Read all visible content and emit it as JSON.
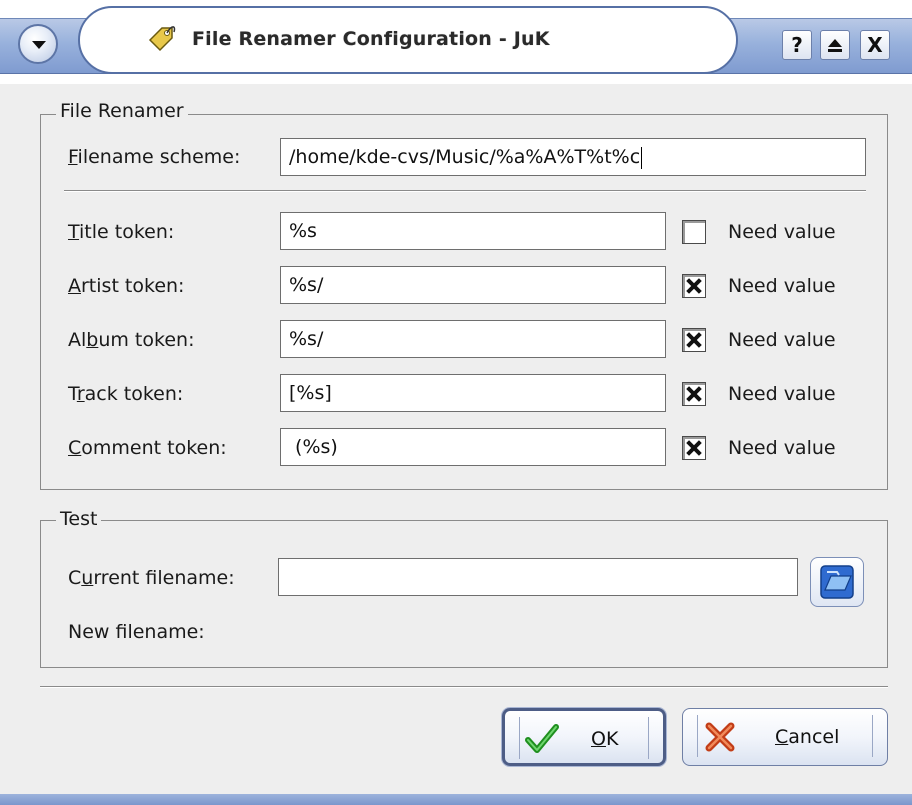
{
  "window": {
    "title": "File Renamer Configuration - JuK",
    "buttons": {
      "help": "?",
      "maximize": "▲",
      "close": "X"
    }
  },
  "renamer": {
    "group_title": "File Renamer",
    "scheme": {
      "label_u": "F",
      "label_rest": "ilename scheme:",
      "value": "/home/kde-cvs/Music/%a%A%T%t%c"
    },
    "need_value_label": "Need value",
    "tokens": [
      {
        "pre": "",
        "u": "T",
        "post": "itle token:",
        "value": "%s",
        "need": false
      },
      {
        "pre": "",
        "u": "A",
        "post": "rtist token:",
        "value": "%s/",
        "need": true
      },
      {
        "pre": "Al",
        "u": "b",
        "post": "um token:",
        "value": "%s/",
        "need": true
      },
      {
        "pre": "T",
        "u": "r",
        "post": "ack token:",
        "value": "[%s]",
        "need": true
      },
      {
        "pre": "",
        "u": "C",
        "post": "omment token:",
        "value": " (%s)",
        "need": true
      }
    ]
  },
  "test": {
    "group_title": "Test",
    "current_label_pre": "C",
    "current_label_u": "u",
    "current_label_post": "rrent filename:",
    "current_value": "",
    "new_label": "New filename:"
  },
  "dialog": {
    "ok_u": "O",
    "ok_rest": "K",
    "cancel_u": "C",
    "cancel_rest": "ancel"
  },
  "colors": {
    "title_gradient": "#98b1dc",
    "ok_check": "#2aa32a",
    "cancel_x": "#e05020"
  }
}
